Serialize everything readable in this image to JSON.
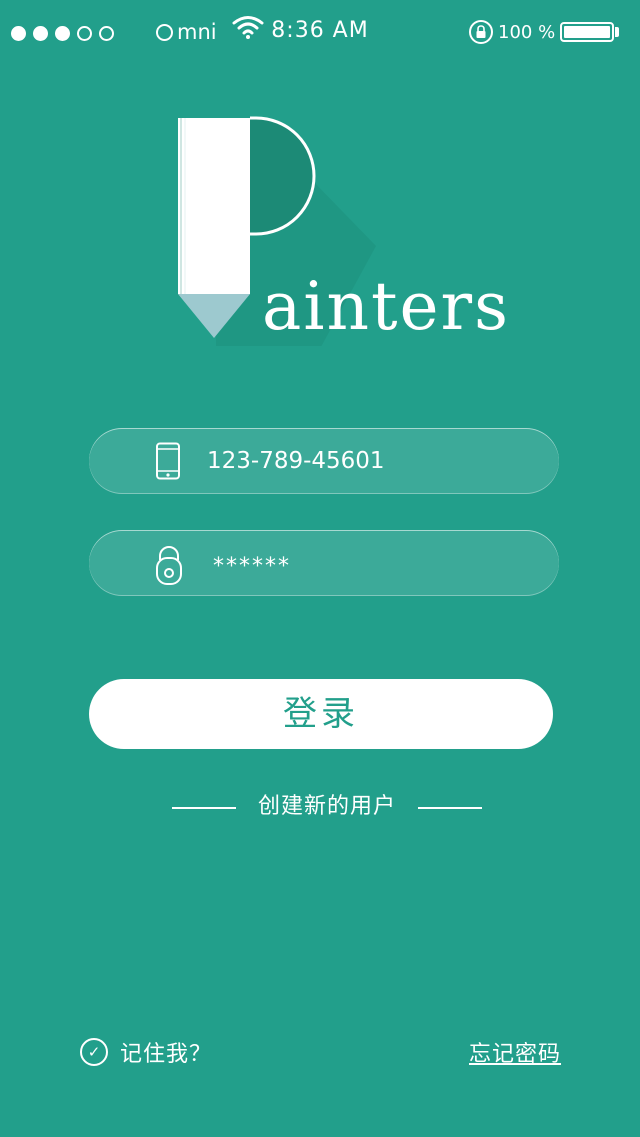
{
  "status_bar": {
    "signal_dots": [
      true,
      true,
      true,
      false,
      false
    ],
    "carrier": "mni",
    "time": "8:36 AM",
    "battery_percent_text": "100 %",
    "battery_level": 1.0
  },
  "logo": {
    "wordmark": "ainters",
    "letter_icon": "pencil-p-logo-icon"
  },
  "form": {
    "phone_value": "123-789-45601",
    "phone_icon": "phone-icon",
    "password_value": "******",
    "password_icon": "lock-icon"
  },
  "login_label": "登录",
  "create_user_label": "创建新的用户",
  "remember": {
    "label": "记住我？",
    "icon": "check-circle-icon",
    "checked": true
  },
  "forgot_password_label": "忘记密码",
  "colors": {
    "background": "#229f8b",
    "button_text": "#229f8b",
    "logo_tip": "#9dc9cf"
  }
}
